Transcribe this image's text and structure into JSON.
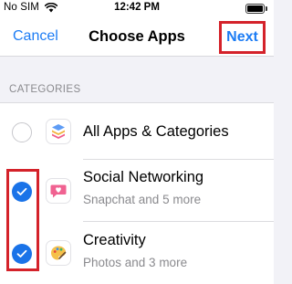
{
  "status_bar": {
    "carrier": "No SIM",
    "wifi_icon": "wifi-icon",
    "time": "12:42 PM",
    "battery_icon": "battery-icon"
  },
  "nav": {
    "cancel_label": "Cancel",
    "title": "Choose Apps",
    "next_label": "Next"
  },
  "section_header": "CATEGORIES",
  "rows": [
    {
      "title": "All Apps & Categories",
      "subtitle": "",
      "checked": false,
      "icon": "stacked-layers-icon"
    },
    {
      "title": "Social Networking",
      "subtitle": "Snapchat and 5 more",
      "checked": true,
      "icon": "chat-heart-icon"
    },
    {
      "title": "Creativity",
      "subtitle": "Photos and 3 more",
      "checked": true,
      "icon": "palette-icon"
    }
  ],
  "colors": {
    "accent_blue": "#1c7cf4",
    "checkbox_blue": "#1a73e8",
    "highlight_red": "#d4222a",
    "grouped_background": "#f2f2f7"
  }
}
